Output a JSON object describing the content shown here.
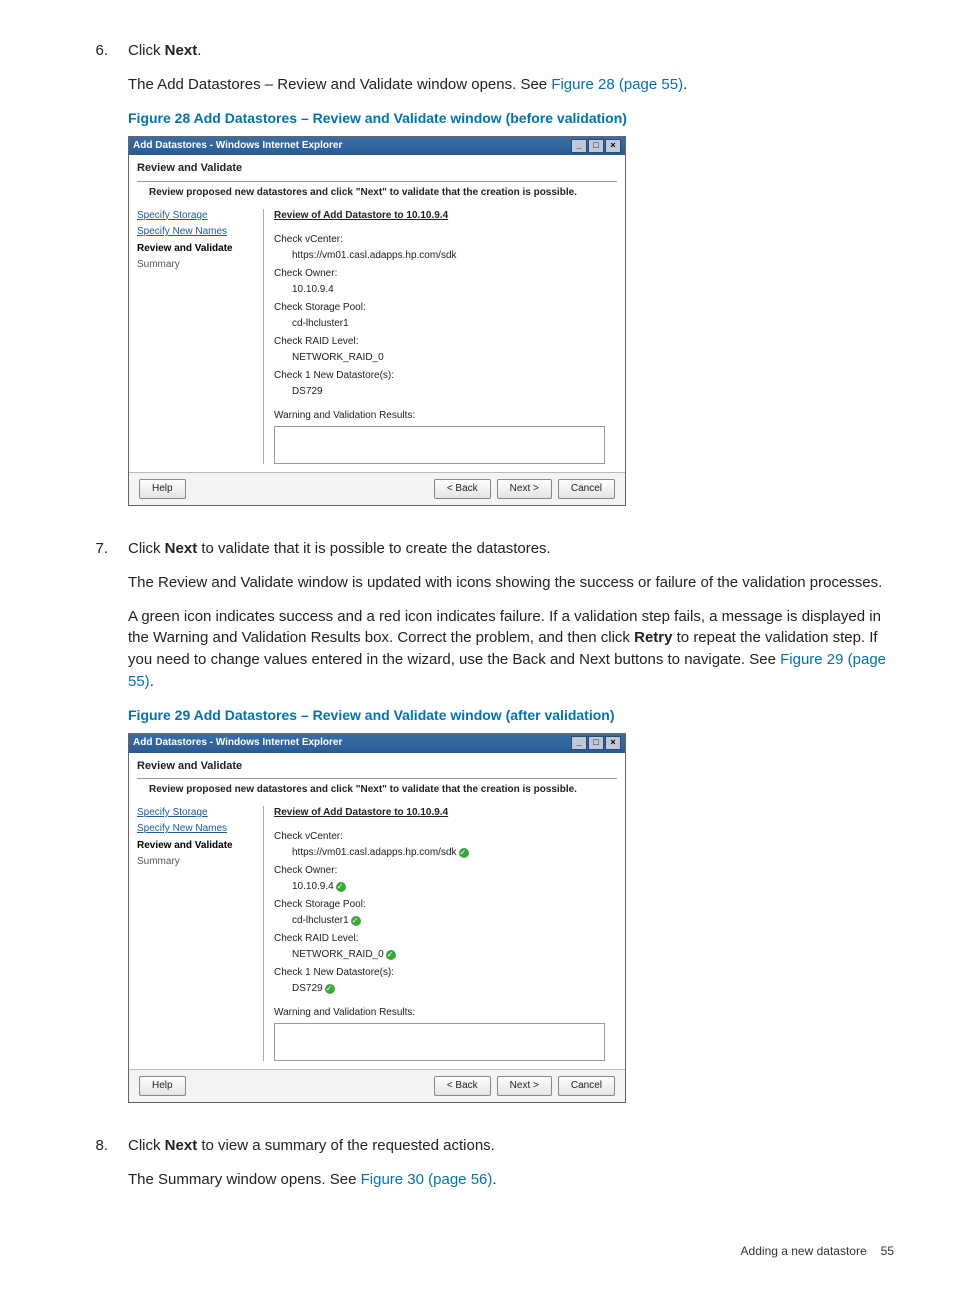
{
  "steps": {
    "s6": {
      "num": "6.",
      "line1a": "Click ",
      "line1b": "Next",
      "line1c": ".",
      "line2a": "The Add Datastores – Review and Validate window opens. See ",
      "line2link": "Figure 28 (page 55)",
      "line2b": "."
    },
    "s7": {
      "num": "7.",
      "line1a": "Click ",
      "line1b": "Next",
      "line1c": " to validate that it is possible to create the datastores.",
      "para2": "The Review and Validate window is updated with icons showing the success or failure of the validation processes.",
      "para3a": "A green icon indicates success and a red icon indicates failure. If a validation step fails, a message is displayed in the Warning and Validation Results box. Correct the problem, and then click ",
      "para3b": "Retry",
      "para3c": " to repeat the validation step. If you need to change values entered in the wizard, use the Back and Next buttons to navigate. See ",
      "para3link": "Figure 29 (page 55)",
      "para3d": "."
    },
    "s8": {
      "num": "8.",
      "line1a": "Click ",
      "line1b": "Next",
      "line1c": " to view a summary of the requested actions.",
      "line2a": "The Summary window opens. See ",
      "line2link": "Figure 30 (page 56)",
      "line2b": "."
    }
  },
  "fig28": {
    "caption": "Figure 28 Add Datastores – Review and Validate window (before validation)"
  },
  "fig29": {
    "caption": "Figure 29 Add Datastores – Review and Validate window (after validation)"
  },
  "win": {
    "title": "Add Datastores - Windows Internet Explorer",
    "header": "Review and Validate",
    "instr": "Review proposed new datastores and click \"Next\" to validate that the creation is possible.",
    "steps": {
      "a": "Specify Storage",
      "b": "Specify New Names",
      "c": "Review and Validate",
      "d": "Summary"
    },
    "review_title": "Review of Add Datastore to 10.10.9.4",
    "items": {
      "vc_lbl": "Check vCenter:",
      "vc_val": "https://vm01.casl.adapps.hp.com/sdk",
      "own_lbl": "Check Owner:",
      "own_val": "10.10.9.4",
      "sp_lbl": "Check Storage Pool:",
      "sp_val": "cd-lhcluster1",
      "raid_lbl": "Check RAID Level:",
      "raid_val": "NETWORK_RAID_0",
      "ds_lbl": "Check 1 New Datastore(s):",
      "ds_val": "DS729"
    },
    "warn_lbl": "Warning and Validation Results:",
    "buttons": {
      "help": "Help",
      "back": "< Back",
      "next": "Next >",
      "cancel": "Cancel"
    }
  },
  "footer": {
    "label": "Adding a new datastore",
    "page": "55"
  }
}
